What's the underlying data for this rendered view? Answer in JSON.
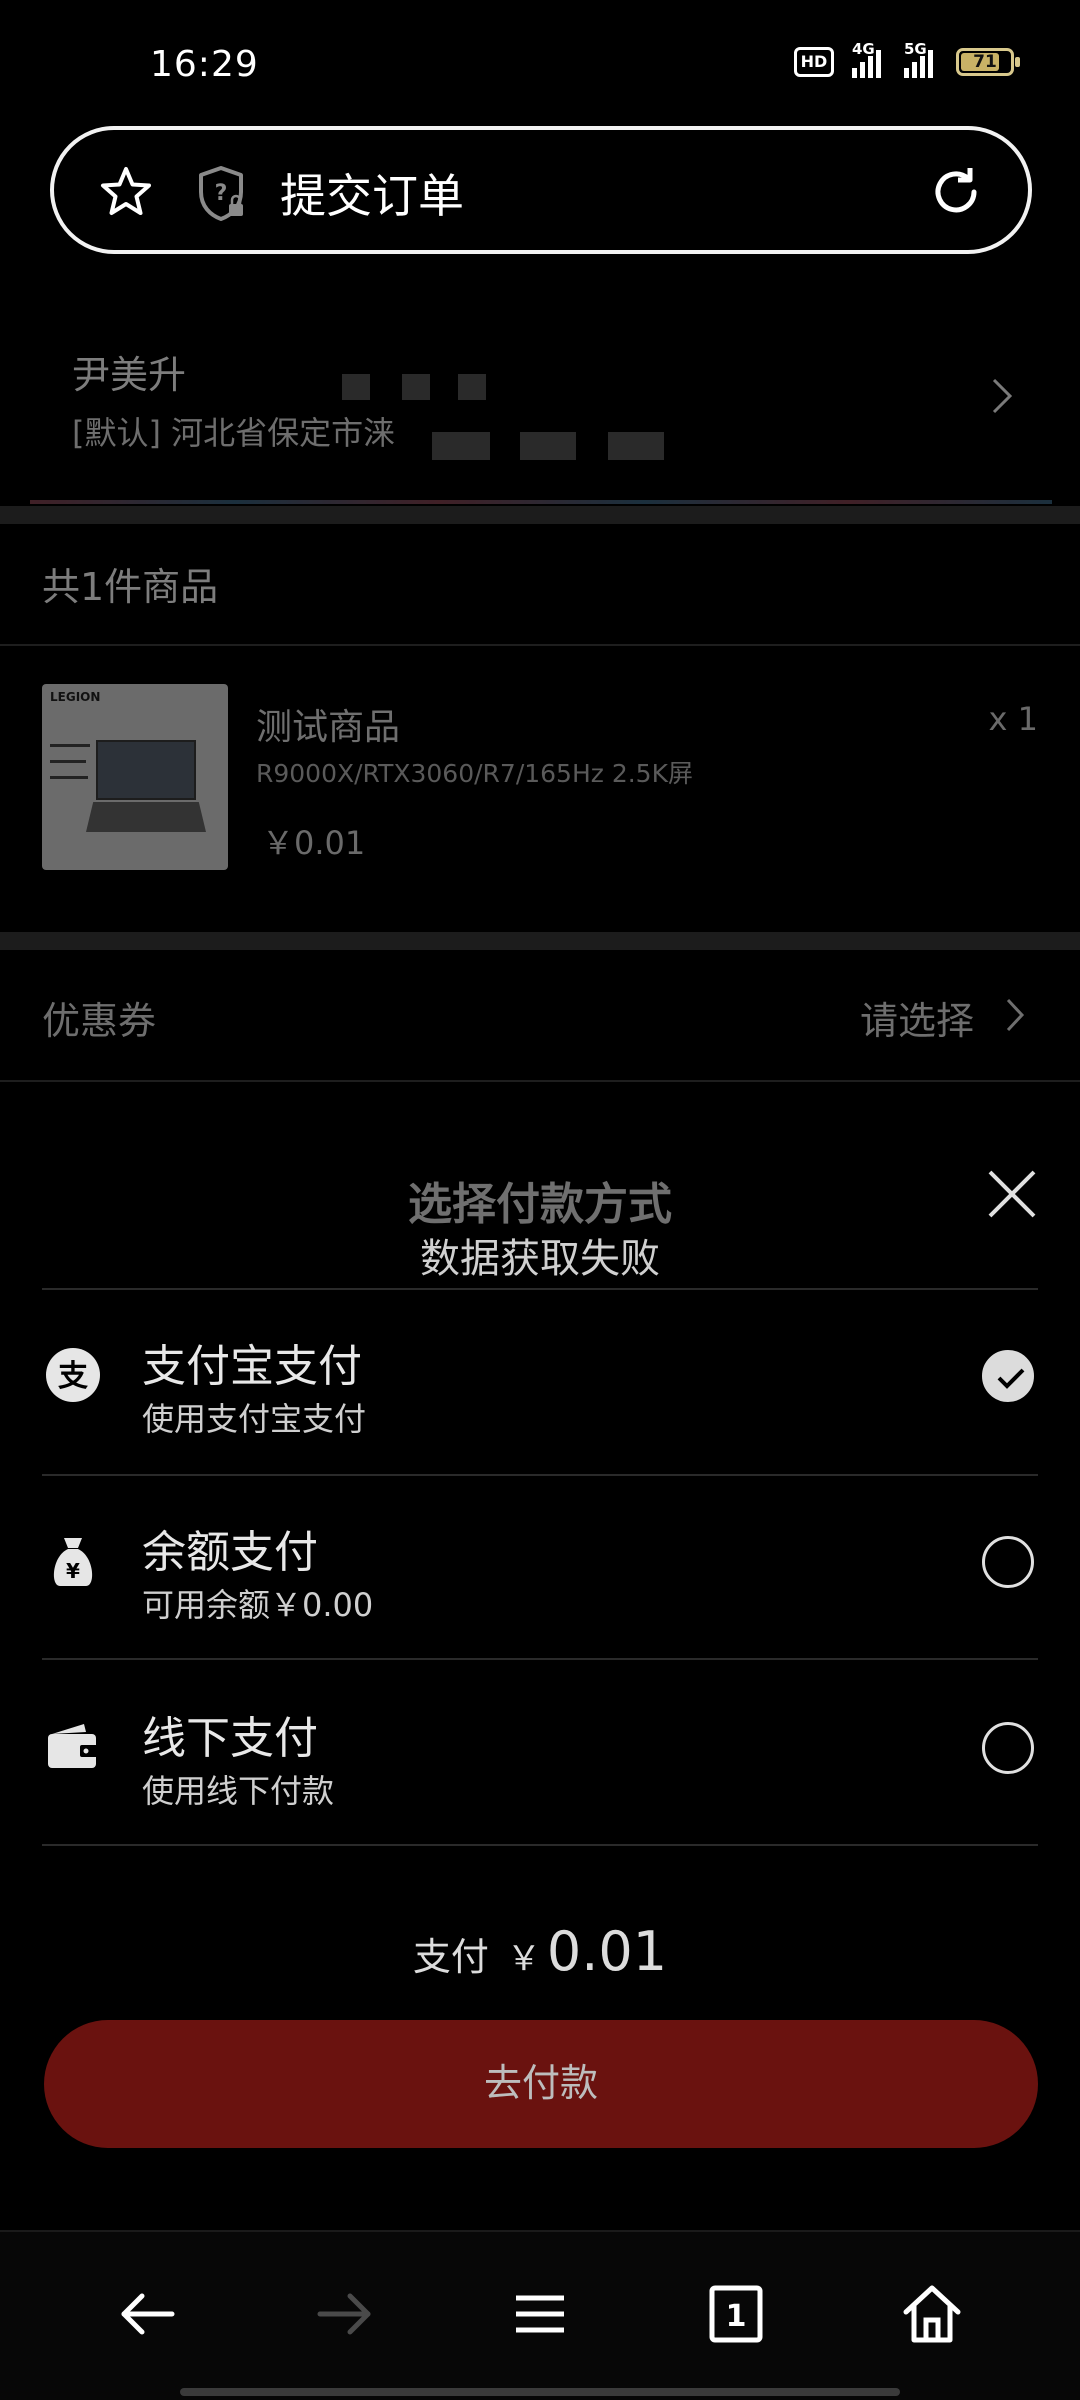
{
  "status": {
    "time": "16:29",
    "hd": "HD",
    "net1": "4G",
    "net2": "5G",
    "battery": "71"
  },
  "url_bar": {
    "title": "提交订单"
  },
  "address": {
    "name": "尹美升",
    "line": "[默认] 河北省保定市涞"
  },
  "goods": {
    "count_label": "共1件商品",
    "items": [
      {
        "brand": "LEGION",
        "name": "测试商品",
        "spec": "R9000X/RTX3060/R7/165Hz 2.5K屏",
        "price": "￥0.01",
        "qty": "x 1"
      }
    ]
  },
  "coupon": {
    "label": "优惠券",
    "value": "请选择"
  },
  "payment": {
    "title": "选择付款方式",
    "toast": "数据获取失败",
    "methods": [
      {
        "name": "支付宝支付",
        "sub": "使用支付宝支付",
        "icon": "alipay-icon",
        "selected": true
      },
      {
        "name": "余额支付",
        "sub": "可用余额￥0.00",
        "icon": "money-bag-icon",
        "selected": false
      },
      {
        "name": "线下支付",
        "sub": "使用线下付款",
        "icon": "wallet-icon",
        "selected": false
      }
    ],
    "total_label": "支付",
    "total_currency": "￥",
    "total_amount": "0.01",
    "pay_button": "去付款"
  },
  "nav": {
    "tabs_count": "1"
  },
  "colors": {
    "pay_button": "#6a120f",
    "background": "#000000"
  }
}
